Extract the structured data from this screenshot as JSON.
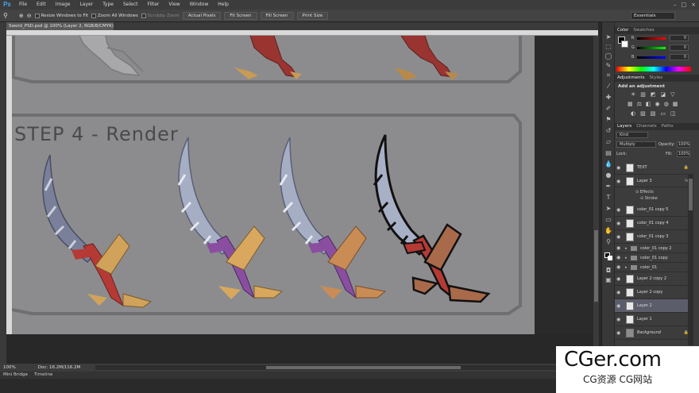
{
  "app": {
    "logo": "Ps"
  },
  "menu": [
    "File",
    "Edit",
    "Image",
    "Layer",
    "Type",
    "Select",
    "Filter",
    "View",
    "Window",
    "Help"
  ],
  "window_controls": [
    "–",
    "□",
    "×"
  ],
  "options_bar": {
    "resize_windows": "Resize Windows to Fit",
    "zoom_all_windows": "Zoom All Windows",
    "scrubby_zoom": "Scrubby Zoom",
    "actual_pixels": "Actual Pixels",
    "fit_screen": "Fit Screen",
    "fill_screen": "Fill Screen",
    "print_size": "Print Size",
    "workspace": "Essentials"
  },
  "document": {
    "tab_title": "Sword_PSD.psd @ 100% (Layer 2, RGB/8/CMYK) *",
    "step_title": "STEP 4 - Render"
  },
  "status": {
    "zoom": "100%",
    "doc": "Doc: 16.2M/116.2M"
  },
  "bottom_tabs": [
    "Mini Bridge",
    "Timeline"
  ],
  "color_panel": {
    "tabs": [
      "Color",
      "Swatches"
    ],
    "channels": [
      {
        "label": "R",
        "value": "0"
      },
      {
        "label": "G",
        "value": "0"
      },
      {
        "label": "B",
        "value": "0"
      }
    ]
  },
  "adjustments_panel": {
    "tabs": [
      "Adjustments",
      "Styles"
    ],
    "title": "Add an adjustment"
  },
  "layers_panel": {
    "tabs": [
      "Layers",
      "Channels",
      "Paths"
    ],
    "filter": "Kind",
    "blend_mode": "Multiply",
    "opacity_label": "Opacity:",
    "opacity": "100%",
    "lock_label": "Lock:",
    "fill_label": "Fill:",
    "fill": "100%",
    "layers": [
      {
        "name": "TEXT"
      },
      {
        "name": "Layer 3"
      },
      {
        "name": "color_01 copy 5"
      },
      {
        "name": "color_01 copy 4"
      },
      {
        "name": "color_01 copy 3"
      },
      {
        "name": "color_01 copy 2"
      },
      {
        "name": "color_01 copy"
      },
      {
        "name": "color_01"
      },
      {
        "name": "Layer 2 copy 2"
      },
      {
        "name": "Layer 2 copy"
      },
      {
        "name": "Layer 2"
      },
      {
        "name": "Layer 1"
      },
      {
        "name": "Background"
      }
    ],
    "effects_label": "Effects",
    "stroke_label": "Stroke"
  },
  "watermark": {
    "main": "CGer.com",
    "sub": "CG资源 CG网站"
  },
  "colors": {
    "canvas": "#8c8c8e",
    "panel": "#3c3c3c",
    "selection": "#5b5d6a"
  }
}
